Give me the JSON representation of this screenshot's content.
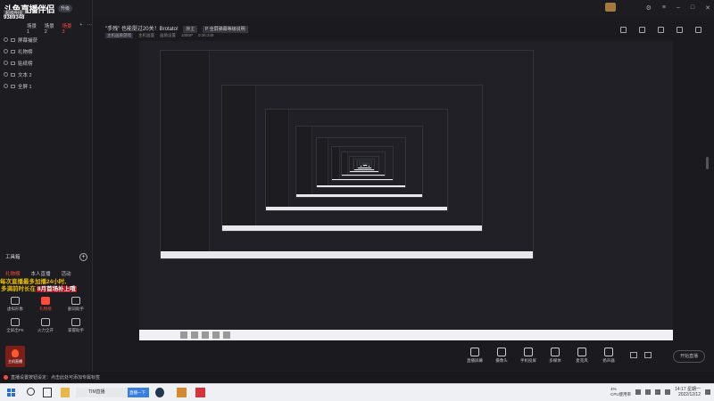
{
  "app": {
    "logo": "斗鱼直播伴侣",
    "version_badge": "升级",
    "uid_badge": "超级明星",
    "uid": "9389348"
  },
  "scenes": {
    "tabs": [
      "场景 1",
      "场景 2",
      "场景 3"
    ],
    "active_index": 2,
    "add": "+",
    "more": "···"
  },
  "sources": [
    {
      "label": "屏幕捕获"
    },
    {
      "label": "礼物榜"
    },
    {
      "label": "贴纸榜"
    },
    {
      "label": "文本 2"
    },
    {
      "label": "全屏 1"
    }
  ],
  "room": {
    "title": "\"手残\" 也能挺过20关！Brotato!",
    "tag": "换主",
    "tag2": "P 全屏弹幕等级说明",
    "sub": [
      "主机画质游戏",
      "主机画面",
      "画质设置",
      "1080P",
      "0:36:348"
    ]
  },
  "toolbox": {
    "title": "工具箱",
    "add_label": "+",
    "tabs": [
      "礼物榜",
      "本人直播",
      "活动"
    ],
    "active_tab": 0,
    "items": [
      {
        "label": "虚拟形象",
        "icon": "avatar-icon"
      },
      {
        "label": "礼物榜",
        "icon": "gift-icon",
        "highlight": true
      },
      {
        "label": "删词助手",
        "icon": "filter-icon"
      },
      {
        "label": "全屏出PK",
        "icon": "pk-icon"
      },
      {
        "label": "火力全开",
        "icon": "fire-icon"
      },
      {
        "label": "掌握助手",
        "icon": "helper-icon"
      }
    ],
    "promo_line1": "每次直播最多加播24小时,",
    "promo_line2": "多满前时长在",
    "promo_highlight": "8月首场补上哦",
    "promo_tail": "",
    "special_item": "主机直播"
  },
  "bottom_tools": [
    {
      "label": "直播屏幕",
      "icon": "screen-icon"
    },
    {
      "label": "摄像头",
      "icon": "camera-icon"
    },
    {
      "label": "手机投屏",
      "icon": "phone-icon"
    },
    {
      "label": "多媒体",
      "icon": "media-icon"
    },
    {
      "label": "麦克风",
      "icon": "mic-icon"
    },
    {
      "label": "扬声器",
      "icon": "speaker-icon"
    }
  ],
  "live_button": "开始直播",
  "status": {
    "text": "直播设置按钮设定：点击此处可添加专属标签"
  },
  "taskbar": {
    "ie_label": "TIM直播",
    "app_label": "直播一下",
    "cpu": "4%",
    "cpu_label": "CPU使用率",
    "time": "14:17 星期一",
    "date": "2022/12/12"
  },
  "colors": {
    "accent": "#ff4b3e",
    "promo": "#f0c300"
  }
}
